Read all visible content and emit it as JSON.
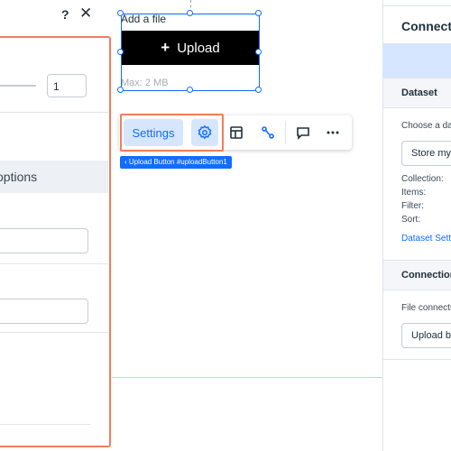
{
  "left_panel": {
    "help_glyph": "?",
    "close_glyph": "✕",
    "number_value": "1",
    "options_header": "options",
    "glyph_a": "/",
    "glyph_b": "‹"
  },
  "canvas": {
    "upload_widget": {
      "label": "Add a file",
      "button_icon": "+",
      "button_label": "Upload",
      "max_size": "Max: 2 MB"
    },
    "toolbar": {
      "settings_label": "Settings",
      "icons": [
        "gear-icon",
        "layout-icon",
        "connect-icon",
        "comment-icon",
        "more-icon"
      ]
    },
    "element_tag": "‹ Upload Button #uploadButton1"
  },
  "right_panel": {
    "title": "Connect to data",
    "dataset_section": "Dataset",
    "choose_dataset": "Choose a dataset",
    "dataset_value": "Store my files",
    "collection": "Collection:",
    "items": "Items:",
    "filter": "Filter:",
    "sort": "Sort:",
    "dataset_settings_link": "Dataset Settings",
    "connections_section": "Connections",
    "file_connects": "File connects to",
    "file_connects_value": "Upload button"
  },
  "colors": {
    "accent": "#116dff",
    "highlight": "#f27d5b",
    "selection_fill": "#d6e6fe"
  }
}
